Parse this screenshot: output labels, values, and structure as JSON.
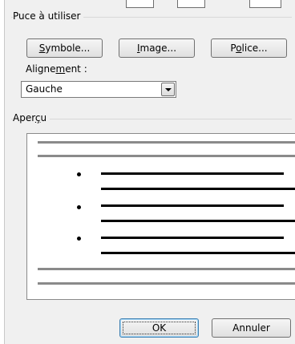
{
  "bullet_group": {
    "title": "Puce à utiliser",
    "buttons": {
      "symbol": {
        "pre": "",
        "mnemonic": "S",
        "post": "ymbole..."
      },
      "image": {
        "pre": "",
        "mnemonic": "I",
        "post": "mage..."
      },
      "font": {
        "pre": "P",
        "mnemonic": "o",
        "post": "lice..."
      }
    },
    "alignment": {
      "label_pre": "Aligne",
      "label_mnemonic": "m",
      "label_post": "ent :",
      "selected": "Gauche",
      "dropdown_icon": "chevron-down-icon"
    }
  },
  "preview_group": {
    "title_pre": "Aper",
    "title_mnemonic": "ç",
    "title_post": "u",
    "bullet_icon": "bullet-dot-icon"
  },
  "footer": {
    "ok_label": "OK",
    "cancel_label": "Annuler"
  },
  "colors": {
    "dialog_background": "#f0f0f0",
    "preview_gray_line": "#8a8a8a",
    "default_button_border": "#3c7fb1"
  }
}
